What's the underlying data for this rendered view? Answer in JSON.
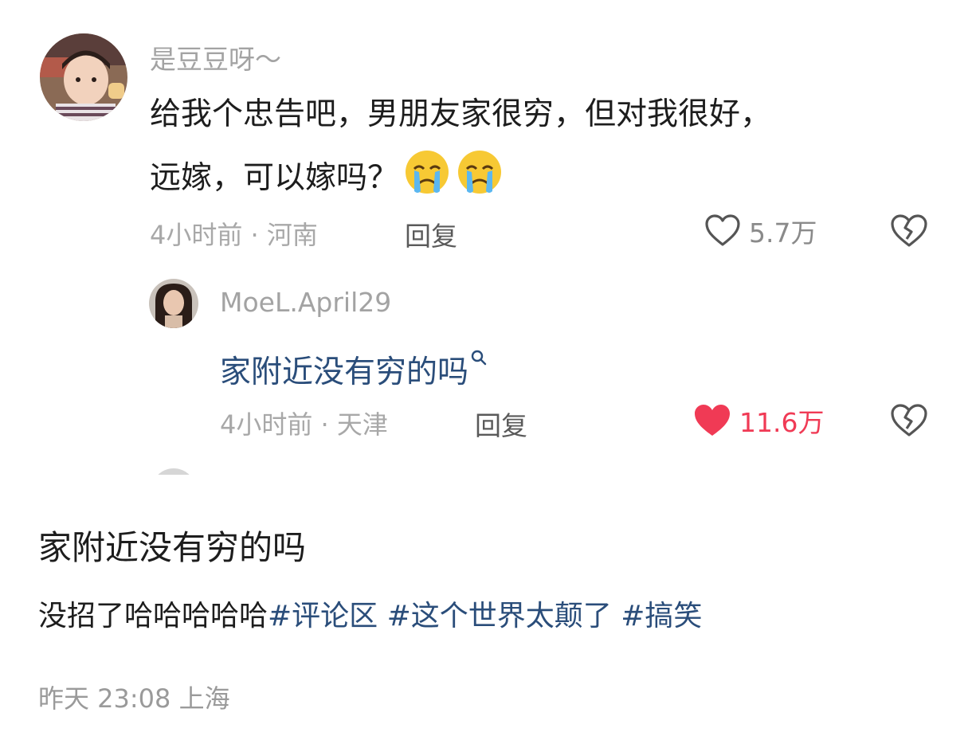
{
  "comment": {
    "username": "是豆豆呀～",
    "text_line1": "给我个忠告吧，男朋友家很穷，但对我很好，",
    "text_line2": "远嫁，可以嫁吗？",
    "emojis": [
      "crying-face-emoji",
      "crying-face-emoji"
    ],
    "time": "4小时前",
    "sep": "·",
    "location": "河南",
    "reply_label": "回复",
    "likes": "5.7万",
    "liked": false
  },
  "reply": {
    "username": "MoeL.April29",
    "text": "家附近没有穷的吗",
    "search_hint_icon": "search-icon",
    "time": "4小时前",
    "sep": "·",
    "location": "天津",
    "reply_label": "回复",
    "likes": "11.6万",
    "liked": true
  },
  "post": {
    "title": "家附近没有穷的吗",
    "body_plain": "没招了哈哈哈哈哈",
    "tags": [
      "#评论区",
      "#这个世界太颠了",
      "#搞笑"
    ],
    "date": "昨天 23:08",
    "location": "上海"
  },
  "colors": {
    "like_active": "#f03a55",
    "tag": "#2a4d7a",
    "reply_text": "#2a4d7a",
    "muted": "#a8a8a8"
  }
}
